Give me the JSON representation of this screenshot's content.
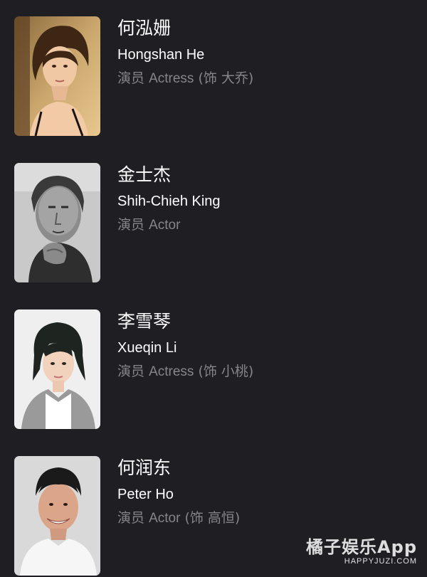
{
  "cast": [
    {
      "name_cn": "何泓姗",
      "name_en": "Hongshan He",
      "role_cn": "演员",
      "role_en": "Actress",
      "character": "(饰 大乔)",
      "photo_icon": "portrait-photo"
    },
    {
      "name_cn": "金士杰",
      "name_en": "Shih-Chieh King",
      "role_cn": "演员",
      "role_en": "Actor",
      "character": "",
      "photo_icon": "portrait-photo"
    },
    {
      "name_cn": "李雪琴",
      "name_en": "Xueqin Li",
      "role_cn": "演员",
      "role_en": "Actress",
      "character": "(饰 小桃)",
      "photo_icon": "portrait-photo"
    },
    {
      "name_cn": "何润东",
      "name_en": "Peter Ho",
      "role_cn": "演员",
      "role_en": "Actor",
      "character": "(饰 高恒)",
      "photo_icon": "portrait-photo"
    }
  ],
  "watermark": {
    "title": "橘子娱乐App",
    "url": "HAPPYJUZI.COM"
  },
  "colors": {
    "background": "#1f1e23",
    "primary_text": "#ffffff",
    "secondary_text": "#86858b"
  }
}
